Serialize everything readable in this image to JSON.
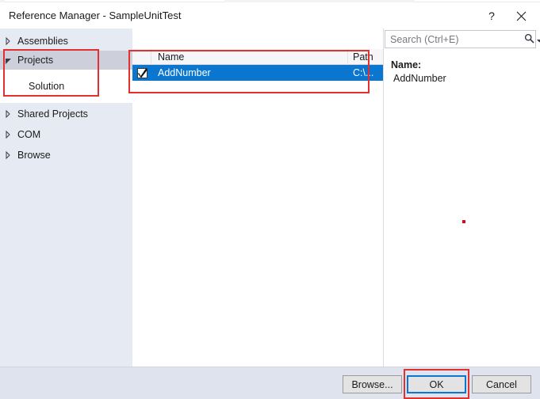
{
  "window": {
    "title": "Reference Manager - SampleUnitTest",
    "help_label": "?",
    "close_label": "close-icon"
  },
  "sidebar": {
    "items": [
      {
        "label": "Assemblies",
        "state": "collapsed",
        "level": 0
      },
      {
        "label": "Projects",
        "state": "expanded",
        "level": 0,
        "selected": true
      },
      {
        "label": "Solution",
        "state": "leaf",
        "level": 1
      },
      {
        "label": "Shared Projects",
        "state": "collapsed",
        "level": 0
      },
      {
        "label": "COM",
        "state": "collapsed",
        "level": 0
      },
      {
        "label": "Browse",
        "state": "collapsed",
        "level": 0
      }
    ]
  },
  "list": {
    "columns": [
      "",
      "Name",
      "Path"
    ],
    "rows": [
      {
        "checked": true,
        "name": "AddNumber",
        "path": "C:\\..."
      }
    ]
  },
  "search": {
    "placeholder": "Search (Ctrl+E)",
    "value": "",
    "icon": "search-icon"
  },
  "details": {
    "name_label": "Name:",
    "name_value": "AddNumber"
  },
  "footer": {
    "browse_label": "Browse...",
    "ok_label": "OK",
    "cancel_label": "Cancel"
  },
  "colors": {
    "selection_blue": "#0b76cf",
    "annotation_red": "#e03030",
    "sidebar_bg": "#e6eaf3",
    "sidebar_selected": "#cdd0db",
    "footer_bg": "#dfe3ee"
  }
}
